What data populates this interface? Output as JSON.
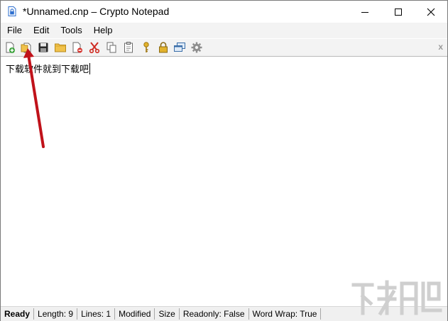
{
  "window": {
    "title": "*Unnamed.cnp – Crypto Notepad",
    "icon": "notepad-lock-icon",
    "caption_buttons": [
      "minimize-icon",
      "maximize-icon",
      "close-icon"
    ]
  },
  "menu": {
    "items": [
      {
        "label": "File"
      },
      {
        "label": "Edit"
      },
      {
        "label": "Tools"
      },
      {
        "label": "Help"
      }
    ]
  },
  "toolbar": {
    "buttons": [
      {
        "icon": "new-file-icon"
      },
      {
        "icon": "open-file-icon"
      },
      {
        "icon": "save-icon"
      },
      {
        "icon": "open-folder-icon"
      },
      {
        "icon": "delete-file-icon"
      },
      {
        "icon": "cut-icon"
      },
      {
        "icon": "copy-icon"
      },
      {
        "icon": "paste-icon"
      },
      {
        "icon": "key-icon"
      },
      {
        "icon": "lock-icon"
      },
      {
        "icon": "windows-icon"
      },
      {
        "icon": "settings-gear-icon"
      }
    ],
    "close_label": "x"
  },
  "editor": {
    "text": "下载软件就到下载吧"
  },
  "status": {
    "ready": "Ready",
    "length": "Length: 9",
    "lines": "Lines: 1",
    "modified": "Modified",
    "size": "Size",
    "readonly": "Readonly: False",
    "word_wrap": "Word Wrap: True"
  },
  "colors": {
    "annotation_arrow": "#c0121a",
    "chrome_background": "#f3f3f3",
    "status_background": "#f0f0f0"
  }
}
